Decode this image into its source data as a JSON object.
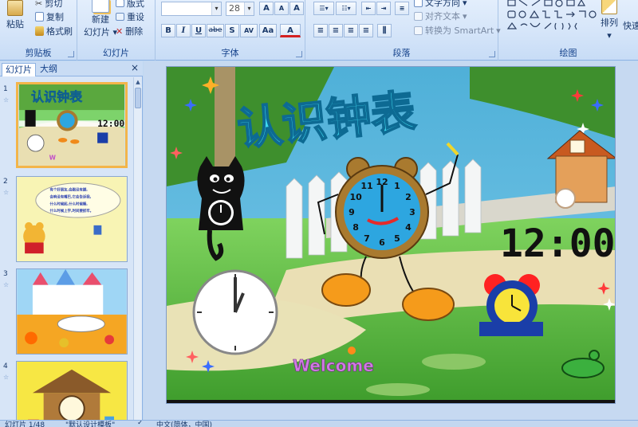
{
  "ribbon": {
    "clipboard": {
      "label": "剪贴板",
      "paste": "粘贴",
      "cut": "剪切",
      "copy": "复制",
      "format_painter": "格式刷"
    },
    "slides": {
      "label": "幻灯片",
      "new_slide_line1": "新建",
      "new_slide_line2": "幻灯片",
      "layout": "版式",
      "reset": "重设",
      "delete": "删除"
    },
    "font": {
      "label": "字体",
      "font_name": "",
      "font_size": "28",
      "grow": "A",
      "shrink": "A",
      "clear": "A",
      "bold": "B",
      "italic": "I",
      "underline": "U",
      "strike": "abe",
      "shadow": "S",
      "spacing": "AV",
      "case": "Aa",
      "color": "A"
    },
    "paragraph": {
      "label": "段落",
      "text_direction": "文字方向",
      "align_text": "对齐文本",
      "smartart": "转换为 SmartArt"
    },
    "drawing": {
      "label": "绘图",
      "arrange": "排列",
      "quick_styles": "快速"
    }
  },
  "panel": {
    "tab_slides": "幻灯片",
    "tab_outline": "大纲",
    "close": "×",
    "thumbnails": [
      {
        "num": "1",
        "title": "认识钟表"
      },
      {
        "num": "2",
        "text_lines": [
          "有个好朋友,会跑没有脚,",
          "会响没有嘴巴,它会告诉我,",
          "什么时候起,什么时候睡,",
          "什么时候上学,时间要抓牢。"
        ]
      },
      {
        "num": "3"
      },
      {
        "num": "4"
      }
    ]
  },
  "slide": {
    "title": "认识钟表",
    "digital_time": "12:00",
    "welcome": "Welcome",
    "clock_numbers": [
      "12",
      "1",
      "2",
      "3",
      "4",
      "5",
      "6",
      "7",
      "8",
      "9",
      "10",
      "11"
    ]
  },
  "status": {
    "slide_index": "幻灯片 1/48",
    "theme": "\"默认设计模板\"",
    "language": "中文(简体，中国)"
  },
  "colors": {
    "ribbon_bg": "#dbe8f9",
    "accent": "#15428b",
    "selection": "#f3b54a",
    "title_cyan": "#39d7ee"
  }
}
